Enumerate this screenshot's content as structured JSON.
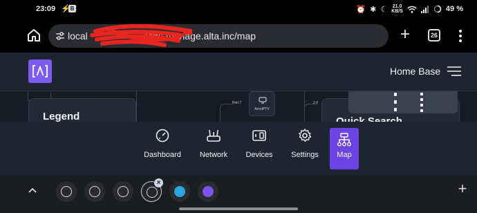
{
  "status_bar": {
    "time": "23:09",
    "net_speed": "21.0",
    "net_unit": "KB/S",
    "battery": "49 %"
  },
  "browser": {
    "url_visible": "local",
    "url_rest": "ddns.manage.alta.inc/map",
    "tab_count": "26"
  },
  "app": {
    "logo_text": "[Λ]",
    "site_name": "Home Base"
  },
  "map": {
    "legend_title": "Legend",
    "quick_search_title": "Quick Search",
    "node_label": "ArrisIPTV",
    "port_label": "Port 7",
    "port_label_2": "2.4"
  },
  "nav": {
    "items": [
      {
        "label": "Dashboard",
        "icon": "gauge-icon"
      },
      {
        "label": "Network",
        "icon": "router-icon"
      },
      {
        "label": "Devices",
        "icon": "devices-icon"
      },
      {
        "label": "Settings",
        "icon": "gear-icon"
      },
      {
        "label": "Map",
        "icon": "sitemap-icon"
      }
    ],
    "active": "Map"
  },
  "colors": {
    "accent": "#6d44e4",
    "app_bg": "#1e2430",
    "map_bg": "#161b24"
  }
}
